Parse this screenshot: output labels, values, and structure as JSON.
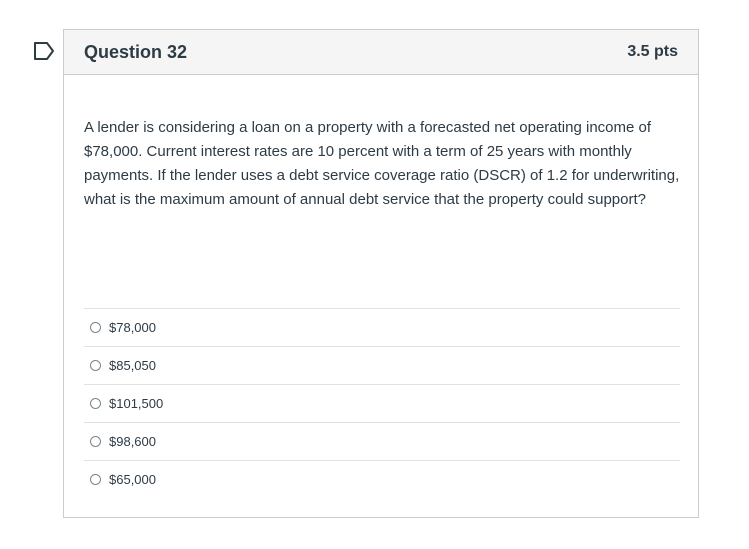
{
  "question": {
    "title": "Question 32",
    "points": "3.5 pts",
    "text": "A lender is considering a loan on a property with a forecasted net operating income of $78,000. Current interest rates are 10 percent with a term of 25 years with monthly payments. If the lender uses a debt service coverage ratio (DSCR) of 1.2 for underwriting, what is the maximum amount of annual debt service that the property could support?",
    "answers": [
      {
        "label": "$78,000"
      },
      {
        "label": "$85,050"
      },
      {
        "label": "$101,500"
      },
      {
        "label": "$98,600"
      },
      {
        "label": "$65,000"
      }
    ]
  },
  "colors": {
    "flag_outline": "#2d3b45",
    "header_bg": "#f5f5f5",
    "border": "#c7cdd1",
    "text": "#2d3b45"
  },
  "icons": {
    "flag": "bookmark-flag-icon",
    "radio": "radio-unselected-icon"
  }
}
